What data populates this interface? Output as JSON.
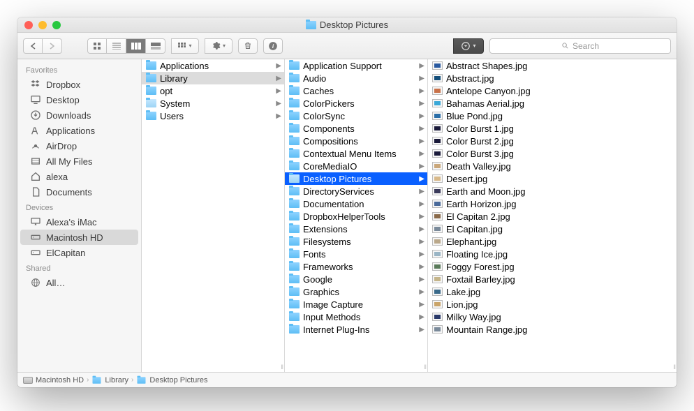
{
  "window": {
    "title": "Desktop Pictures"
  },
  "search": {
    "placeholder": "Search"
  },
  "sidebar": {
    "sections": [
      {
        "header": "Favorites",
        "items": [
          {
            "icon": "dropbox",
            "label": "Dropbox"
          },
          {
            "icon": "desktop",
            "label": "Desktop"
          },
          {
            "icon": "downloads",
            "label": "Downloads"
          },
          {
            "icon": "applications",
            "label": "Applications"
          },
          {
            "icon": "airdrop",
            "label": "AirDrop"
          },
          {
            "icon": "allfiles",
            "label": "All My Files"
          },
          {
            "icon": "home",
            "label": "alexa"
          },
          {
            "icon": "documents",
            "label": "Documents"
          }
        ]
      },
      {
        "header": "Devices",
        "items": [
          {
            "icon": "imac",
            "label": "Alexa's iMac"
          },
          {
            "icon": "hd",
            "label": "Macintosh HD",
            "selected": true
          },
          {
            "icon": "hd",
            "label": "ElCapitan"
          }
        ]
      },
      {
        "header": "Shared",
        "items": [
          {
            "icon": "globe",
            "label": "All…"
          }
        ]
      }
    ]
  },
  "columns": [
    {
      "items": [
        {
          "type": "folder",
          "label": "Applications",
          "arrow": true
        },
        {
          "type": "folder",
          "label": "Library",
          "arrow": true,
          "selected": "gray"
        },
        {
          "type": "folder",
          "label": "opt",
          "arrow": true
        },
        {
          "type": "sysfolder",
          "label": "System",
          "arrow": true
        },
        {
          "type": "folder",
          "label": "Users",
          "arrow": true
        }
      ]
    },
    {
      "items": [
        {
          "type": "folder",
          "label": "Application Support",
          "arrow": true
        },
        {
          "type": "folder",
          "label": "Audio",
          "arrow": true
        },
        {
          "type": "folder",
          "label": "Caches",
          "arrow": true
        },
        {
          "type": "folder",
          "label": "ColorPickers",
          "arrow": true
        },
        {
          "type": "folder",
          "label": "ColorSync",
          "arrow": true
        },
        {
          "type": "folder",
          "label": "Components",
          "arrow": true
        },
        {
          "type": "folder",
          "label": "Compositions",
          "arrow": true
        },
        {
          "type": "folder",
          "label": "Contextual Menu Items",
          "arrow": true
        },
        {
          "type": "folder",
          "label": "CoreMediaIO",
          "arrow": true
        },
        {
          "type": "folder",
          "label": "Desktop Pictures",
          "arrow": true,
          "selected": "blue"
        },
        {
          "type": "folder",
          "label": "DirectoryServices",
          "arrow": true
        },
        {
          "type": "folder",
          "label": "Documentation",
          "arrow": true
        },
        {
          "type": "folder",
          "label": "DropboxHelperTools",
          "arrow": true
        },
        {
          "type": "folder",
          "label": "Extensions",
          "arrow": true
        },
        {
          "type": "folder",
          "label": "Filesystems",
          "arrow": true
        },
        {
          "type": "folder",
          "label": "Fonts",
          "arrow": true
        },
        {
          "type": "folder",
          "label": "Frameworks",
          "arrow": true
        },
        {
          "type": "folder",
          "label": "Google",
          "arrow": true
        },
        {
          "type": "folder",
          "label": "Graphics",
          "arrow": true
        },
        {
          "type": "folder",
          "label": "Image Capture",
          "arrow": true
        },
        {
          "type": "folder",
          "label": "Input Methods",
          "arrow": true
        },
        {
          "type": "folder",
          "label": "Internet Plug-Ins",
          "arrow": true
        }
      ]
    },
    {
      "items": [
        {
          "type": "img",
          "color": "#2a5aa0",
          "label": "Abstract Shapes.jpg"
        },
        {
          "type": "img",
          "color": "#134e7a",
          "label": "Abstract.jpg"
        },
        {
          "type": "img",
          "color": "#c9724a",
          "label": "Antelope Canyon.jpg"
        },
        {
          "type": "img",
          "color": "#3aa8d8",
          "label": "Bahamas Aerial.jpg"
        },
        {
          "type": "img",
          "color": "#2a6ea8",
          "label": "Blue Pond.jpg"
        },
        {
          "type": "img",
          "color": "#1a1a3a",
          "label": "Color Burst 1.jpg"
        },
        {
          "type": "img",
          "color": "#1a1a3a",
          "label": "Color Burst 2.jpg"
        },
        {
          "type": "img",
          "color": "#1a1a3a",
          "label": "Color Burst 3.jpg"
        },
        {
          "type": "img",
          "color": "#caa77a",
          "label": "Death Valley.jpg"
        },
        {
          "type": "img",
          "color": "#d8b98a",
          "label": "Desert.jpg"
        },
        {
          "type": "img",
          "color": "#3a3a5a",
          "label": "Earth and Moon.jpg"
        },
        {
          "type": "img",
          "color": "#4a6a9a",
          "label": "Earth Horizon.jpg"
        },
        {
          "type": "img",
          "color": "#8a6a4a",
          "label": "El Capitan 2.jpg"
        },
        {
          "type": "img",
          "color": "#7a8a9a",
          "label": "El Capitan.jpg"
        },
        {
          "type": "img",
          "color": "#baa88a",
          "label": "Elephant.jpg"
        },
        {
          "type": "img",
          "color": "#9ab5c5",
          "label": "Floating Ice.jpg"
        },
        {
          "type": "img",
          "color": "#5a7a5a",
          "label": "Foggy Forest.jpg"
        },
        {
          "type": "img",
          "color": "#c5b58a",
          "label": "Foxtail Barley.jpg"
        },
        {
          "type": "img",
          "color": "#3a6a8a",
          "label": "Lake.jpg"
        },
        {
          "type": "img",
          "color": "#caa56a",
          "label": "Lion.jpg"
        },
        {
          "type": "img",
          "color": "#2a3a6a",
          "label": "Milky Way.jpg"
        },
        {
          "type": "img",
          "color": "#7a8a9a",
          "label": "Mountain Range.jpg"
        }
      ]
    }
  ],
  "pathbar": [
    {
      "icon": "hd",
      "label": "Macintosh HD"
    },
    {
      "icon": "folder",
      "label": "Library"
    },
    {
      "icon": "folder",
      "label": "Desktop Pictures"
    }
  ]
}
